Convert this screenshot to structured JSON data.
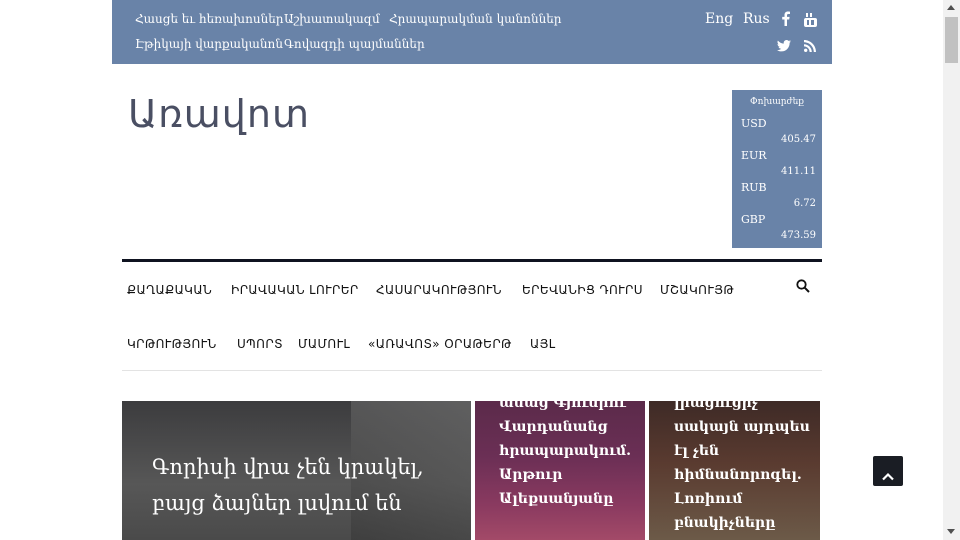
{
  "topbar": {
    "links_row1": [
      "Հասցե եւ հեռախոսներ",
      "Աշխատակազմ",
      "Հրապարակման կանոններ"
    ],
    "links_row2": [
      "Էթիկայի վարքականոն",
      "Գովազդի պայմաններ"
    ],
    "lang_en": "Eng",
    "lang_ru": "Rus",
    "social_icons": [
      "facebook-icon",
      "youtube-icon",
      "twitter-icon",
      "rss-icon"
    ]
  },
  "logo": {
    "text": "Առավոտ"
  },
  "currency": {
    "title": "Փոխարժեք",
    "rates": [
      {
        "code": "USD",
        "rate": "405.47"
      },
      {
        "code": "EUR",
        "rate": "411.11"
      },
      {
        "code": "RUB",
        "rate": "6.72"
      },
      {
        "code": "GBP",
        "rate": "473.59"
      }
    ]
  },
  "nav": {
    "row1": [
      "ՔԱՂԱՔԱԿԱՆ",
      "ԻՐԱՎԱԿԱՆ ԼՈՒՐԵՐ",
      "ՀԱՍԱՐԱԿՈՒԹՅՈՒՆ",
      "ԵՐԵՎԱՆԻՑ ԴՈՒՐՍ",
      "ՄՇԱԿՈՒՅԹ"
    ],
    "row2": [
      "ԿՐԹՈՒԹՅՈՒՆ",
      "ՍՊՈՐՏ",
      "ՄԱՄՈՒԼ",
      "«ԱՌԱՎՈՏ» ՕՐԱԹԵՐԹ",
      "ԱՅԼ"
    ],
    "search_icon": "search-icon"
  },
  "articles": {
    "main_title": "Գորիսի վրա չեն կրակել, բայց ձայներ լսվում են",
    "card2_title": "ասաց Գյումրու Վարդանանց հրապարակում. Արթուր Ալեքսանյանը",
    "card3_title": "լրացուցիչ սակայն այդպես էլ չեն հիմնանորոգել. Լոռիում բնակիչները"
  },
  "colors": {
    "topbar": "#6983a8",
    "nav_rule": "#0f1320"
  },
  "scroll_top_icon": "chevron-up-icon"
}
